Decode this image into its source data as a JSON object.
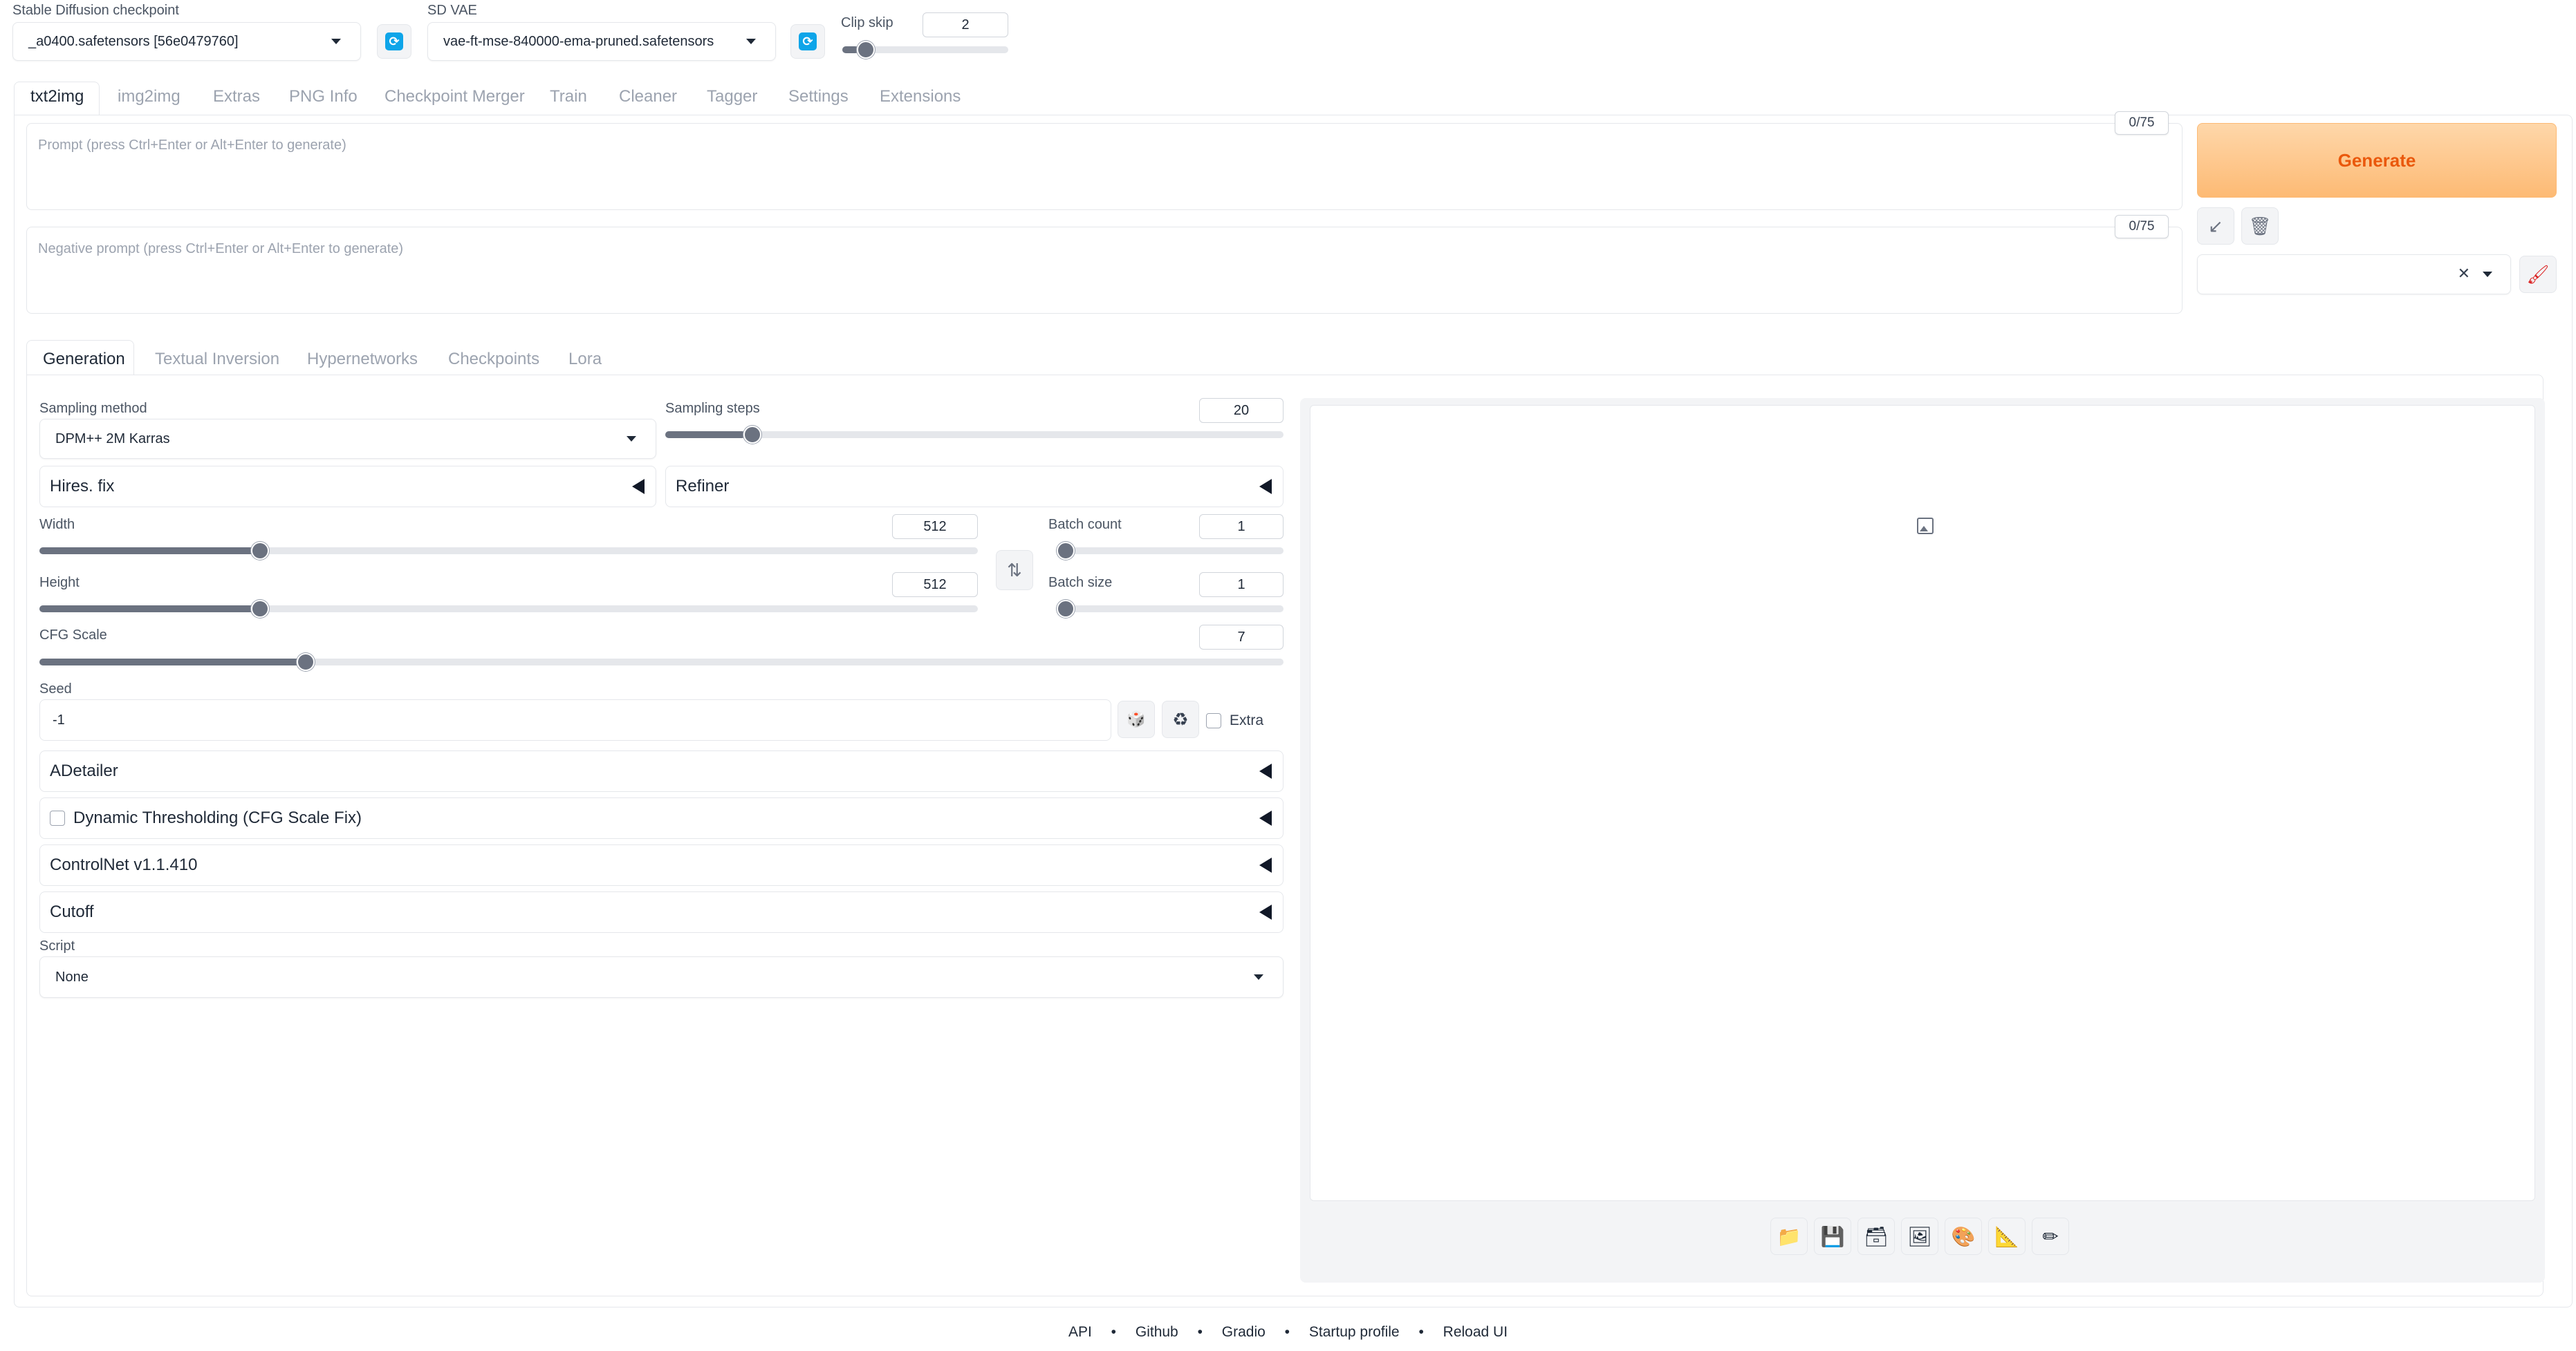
{
  "top": {
    "checkpoint_label": "Stable Diffusion checkpoint",
    "checkpoint_value": "_a0400.safetensors [56e0479760]",
    "vae_label": "SD VAE",
    "vae_value": "vae-ft-mse-840000-ema-pruned.safetensors",
    "clip_skip_label": "Clip skip",
    "clip_skip_value": "2",
    "clip_skip_fraction": 0.1
  },
  "main_tabs": [
    "txt2img",
    "img2img",
    "Extras",
    "PNG Info",
    "Checkpoint Merger",
    "Train",
    "Cleaner",
    "Tagger",
    "Settings",
    "Extensions"
  ],
  "prompt": {
    "placeholder": "Prompt (press Ctrl+Enter or Alt+Enter to generate)",
    "counter": "0/75"
  },
  "negative_prompt": {
    "placeholder": "Negative prompt (press Ctrl+Enter or Alt+Enter to generate)",
    "counter": "0/75"
  },
  "generate_label": "Generate",
  "style_clear": "✕",
  "sub_tabs": [
    "Generation",
    "Textual Inversion",
    "Hypernetworks",
    "Checkpoints",
    "Lora"
  ],
  "sampling": {
    "method_label": "Sampling method",
    "method_value": "DPM++ 2M Karras",
    "steps_label": "Sampling steps",
    "steps_value": "20",
    "steps_fraction": 0.13
  },
  "hires_label": "Hires. fix",
  "refiner_label": "Refiner",
  "width": {
    "label": "Width",
    "value": "512",
    "fraction": 0.23
  },
  "height": {
    "label": "Height",
    "value": "512",
    "fraction": 0.23
  },
  "batch_count": {
    "label": "Batch count",
    "value": "1",
    "fraction": 0.0
  },
  "batch_size": {
    "label": "Batch size",
    "value": "1",
    "fraction": 0.0
  },
  "cfg": {
    "label": "CFG Scale",
    "value": "7",
    "fraction": 0.21
  },
  "seed": {
    "label": "Seed",
    "value": "-1",
    "extra_label": "Extra"
  },
  "accordions": {
    "adetailer": "ADetailer",
    "dynamic_thresholding": "Dynamic Thresholding (CFG Scale Fix)",
    "controlnet": "ControlNet v1.1.410",
    "cutoff": "Cutoff"
  },
  "script": {
    "label": "Script",
    "value": "None"
  },
  "footer": [
    "API",
    "Github",
    "Gradio",
    "Startup profile",
    "Reload UI"
  ],
  "footer_sep": "•",
  "colors": {
    "generate_bg": "#fdba74",
    "generate_text": "#ea580c",
    "accent_blue": "#0ea5e9"
  }
}
